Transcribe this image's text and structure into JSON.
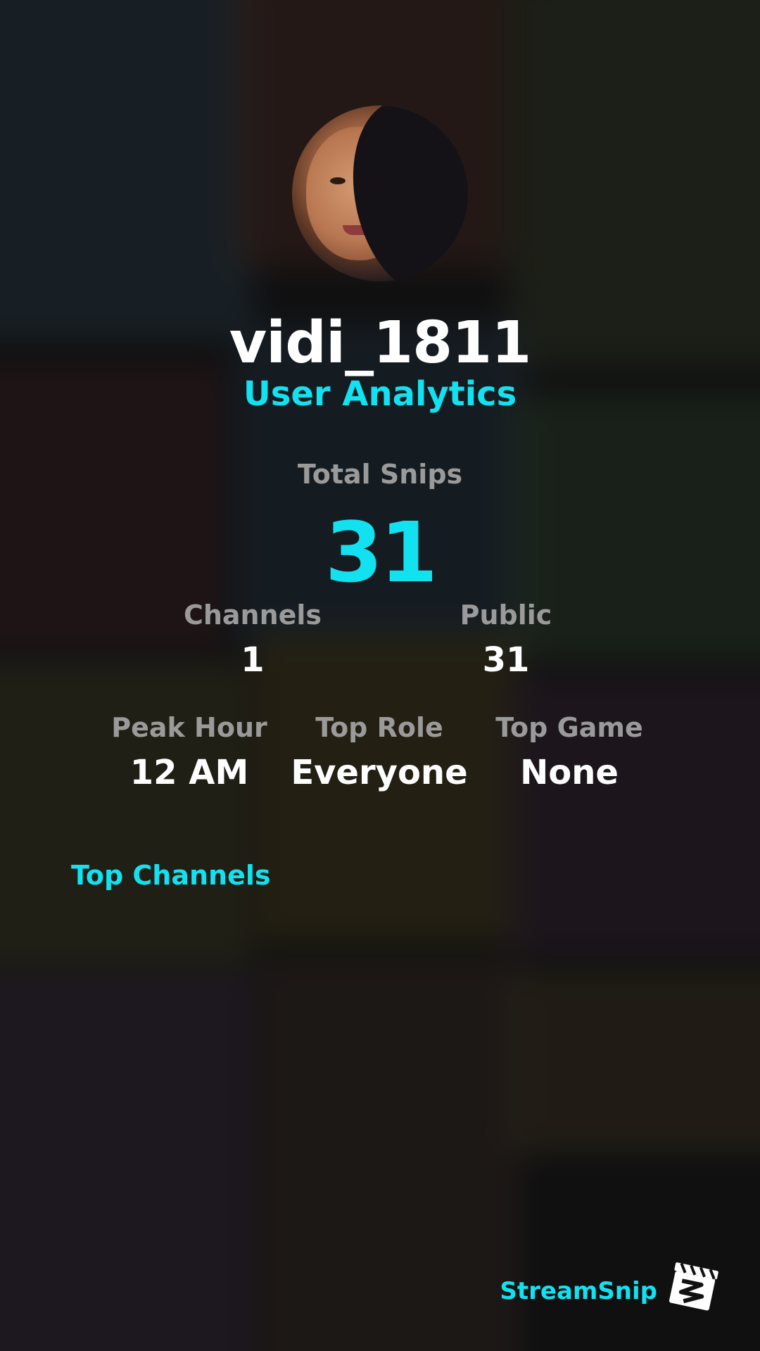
{
  "profile": {
    "username": "vidi_1811",
    "subtitle": "User Analytics"
  },
  "totals": {
    "total_snips_label": "Total Snips",
    "total_snips_value": "31"
  },
  "stats_row1": {
    "channels_label": "Channels",
    "channels_value": "1",
    "public_label": "Public",
    "public_value": "31"
  },
  "stats_row2": {
    "peak_hour_label": "Peak Hour",
    "peak_hour_value": "12 AM",
    "top_role_label": "Top Role",
    "top_role_value": "Everyone",
    "top_game_label": "Top Game",
    "top_game_value": "None"
  },
  "sections": {
    "top_channels_title": "Top Channels"
  },
  "branding": {
    "name": "StreamSnip",
    "logo_icon": "clapperboard-icon"
  },
  "colors": {
    "accent": "#12e1f0",
    "label_gray": "#9a9a9a",
    "text_white": "#ffffff"
  }
}
